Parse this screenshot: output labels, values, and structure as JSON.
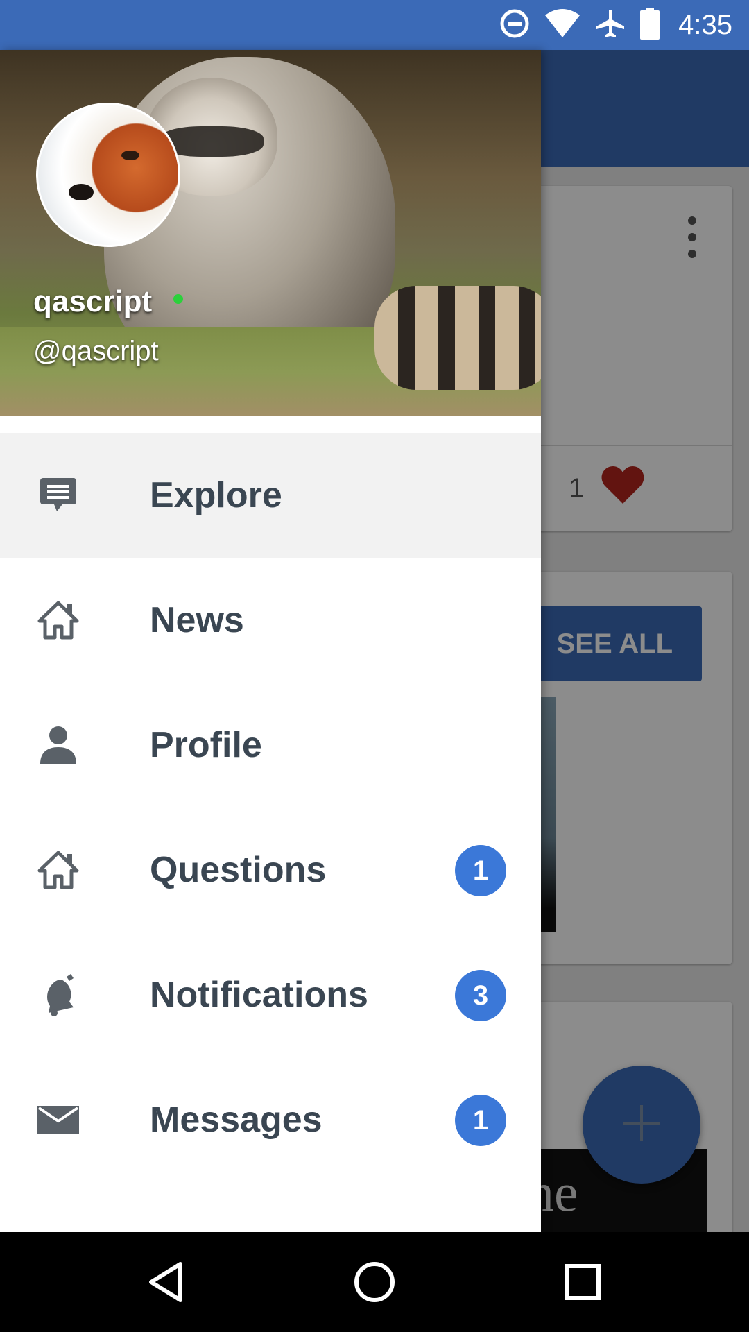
{
  "status_bar": {
    "time": "4:35",
    "icons": [
      "do-not-disturb-icon",
      "wifi-icon",
      "airplane-mode-icon",
      "battery-icon"
    ]
  },
  "background": {
    "card1": {
      "like_count": "1"
    },
    "card2": {
      "see_all_label": "SEE ALL"
    },
    "card3": {
      "banner_fragment": "ne"
    }
  },
  "drawer": {
    "user": {
      "name": "qascript",
      "handle": "@qascript",
      "online": true
    },
    "items": [
      {
        "label": "Explore",
        "icon": "chat-icon",
        "active": true,
        "badge": ""
      },
      {
        "label": "News",
        "icon": "home-icon",
        "active": false,
        "badge": ""
      },
      {
        "label": "Profile",
        "icon": "person-icon",
        "active": false,
        "badge": ""
      },
      {
        "label": "Questions",
        "icon": "home-icon",
        "active": false,
        "badge": "1"
      },
      {
        "label": "Notifications",
        "icon": "bell-icon",
        "active": false,
        "badge": "3"
      },
      {
        "label": "Messages",
        "icon": "mail-icon",
        "active": false,
        "badge": "1"
      }
    ]
  },
  "colors": {
    "primary": "#3b6ab7",
    "badge": "#3b78d8",
    "label": "#3a4652",
    "heart": "#b3261e",
    "online": "#2bd13b"
  },
  "system_nav": [
    "back-icon",
    "home-circle-icon",
    "recents-icon"
  ]
}
